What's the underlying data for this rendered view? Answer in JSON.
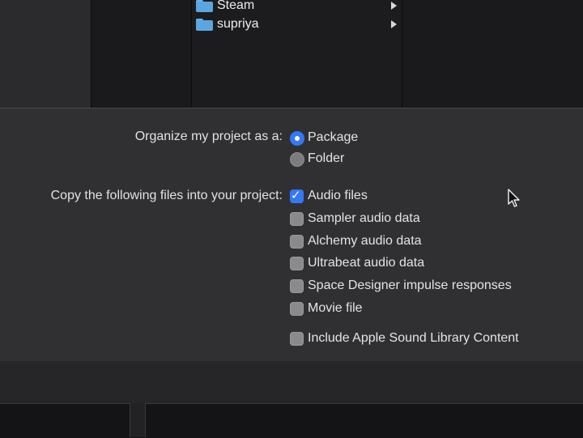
{
  "browser": {
    "folders": [
      {
        "name": "Steam"
      },
      {
        "name": "supriya"
      }
    ],
    "folder_color": "#5aa6e2"
  },
  "options": {
    "organize_label": "Organize my project as a:",
    "organize_choices": [
      {
        "label": "Package",
        "selected": true
      },
      {
        "label": "Folder",
        "selected": false
      }
    ],
    "copy_label": "Copy the following files into your project:",
    "copy_choices": [
      {
        "label": "Audio files",
        "checked": true
      },
      {
        "label": "Sampler audio data",
        "checked": false
      },
      {
        "label": "Alchemy audio data",
        "checked": false
      },
      {
        "label": "Ultrabeat audio data",
        "checked": false
      },
      {
        "label": "Space Designer impulse responses",
        "checked": false
      },
      {
        "label": "Movie file",
        "checked": false
      }
    ],
    "library_choice": {
      "label": "Include Apple Sound Library Content",
      "checked": false
    },
    "accent_color": "#3478f6"
  }
}
